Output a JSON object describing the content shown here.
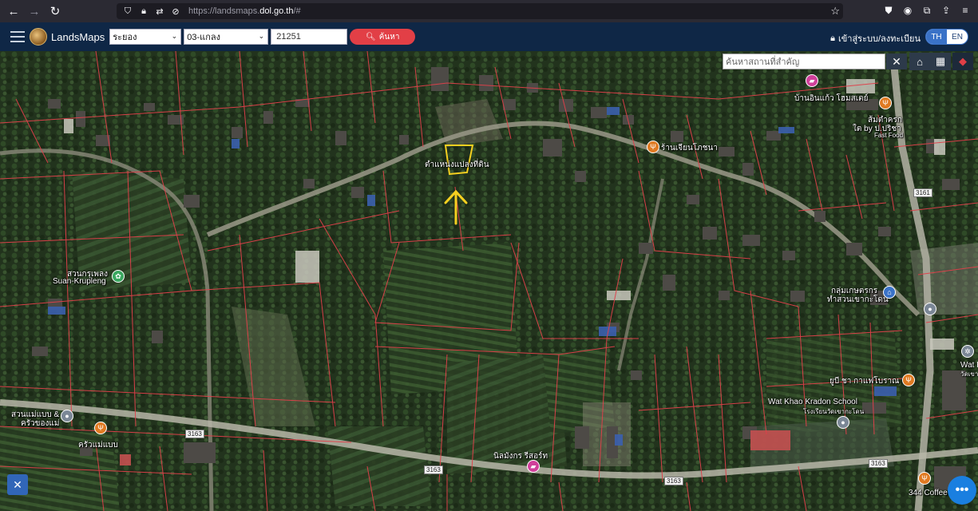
{
  "browser": {
    "url_prefix": "https://landsmaps.",
    "url_domain": "dol.go.th",
    "url_suffix": "/#"
  },
  "header": {
    "brand": "LandsMaps",
    "province": "ระยอง",
    "district": "03-แกลง",
    "parcel_no": "21251",
    "search_label": "ค้นหา",
    "login_label": "เข้าสู่ระบบ/ลงทะเบียน",
    "lang_th": "TH",
    "lang_en": "EN"
  },
  "map": {
    "search_placeholder": "ค้นหาสถานที่สำคัญ",
    "close": "✕",
    "parcel_label": "ตำแหน่งแปลงที่ดิน",
    "labels": {
      "suan_krupleng_th": "สวนกรุเพลง",
      "suan_krupleng_en": "Suan-Krupleng",
      "baan_inkaew": "บ้านอินแก้ว โฮมสเตย์",
      "somtam": "ส้มตำครก",
      "somtam2": "ใต by ป.ปริชา",
      "fastfood": "Fast Food",
      "restaurant_chokchai": "ร้านเจียนโภชนา",
      "farmers_group": "กลุ่มเกษตรกร",
      "farmers_group2": "ทำสวนเขากะโดน",
      "wat_khao_school": "Wat Khao Kradon School",
      "wat_khao_school_th": "โรงเรียนวัดเขากะโดน",
      "yubi_cafe": "ยูบี ชา กาแฟโบราณ",
      "wat_kh": "Wat Kh",
      "wat_kh_th": "วัดเขากะ",
      "suan_maeb": "สวนแม่แบบ &",
      "suan_maeb2": "ครัวของแม่",
      "krua_mae": "ครัวแม่แบบ",
      "nimmangkorn": "นิลมังกร รีสอร์ท",
      "coffee344": "344 Coffee"
    },
    "roads": {
      "r3161": "3161",
      "r3163a": "3163",
      "r3163b": "3163",
      "r3163c": "3163",
      "r3163d": "3163"
    }
  }
}
